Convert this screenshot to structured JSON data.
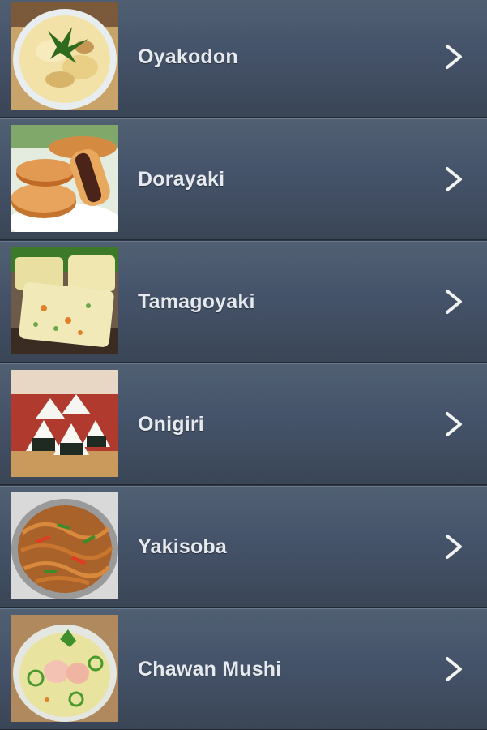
{
  "recipes": [
    {
      "name": "Oyakodon",
      "image": "oyakodon-photo",
      "icon": "chevron-right-icon"
    },
    {
      "name": "Dorayaki",
      "image": "dorayaki-photo",
      "icon": "chevron-right-icon"
    },
    {
      "name": "Tamagoyaki",
      "image": "tamagoyaki-photo",
      "icon": "chevron-right-icon"
    },
    {
      "name": "Onigiri",
      "image": "onigiri-photo",
      "icon": "chevron-right-icon"
    },
    {
      "name": "Yakisoba",
      "image": "yakisoba-photo",
      "icon": "chevron-right-icon"
    },
    {
      "name": "Chawan Mushi",
      "image": "chawan-mushi-photo",
      "icon": "chevron-right-icon"
    }
  ],
  "colors": {
    "row_top": "#506072",
    "row_bottom": "#3a4656",
    "label": "#e6e9ee",
    "chevron": "#f2f2f2"
  }
}
